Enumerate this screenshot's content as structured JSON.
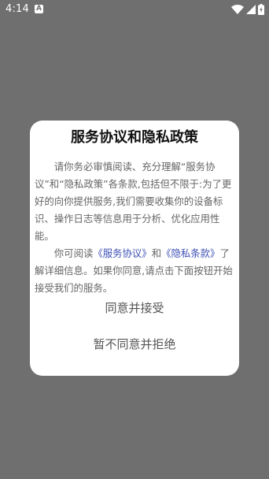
{
  "status_bar": {
    "time": "4:14",
    "notification_letter": "A"
  },
  "dialog": {
    "title": "服务协议和隐私政策",
    "paragraph1": "请你务必审慎阅读、充分理解“服务协议”和“隐私政策”各条款,包括但不限于:为了更好的向你提供服务,我们需要收集你的设备标识、操作日志等信息用于分析、优化应用性能。",
    "paragraph2_prefix": "你可阅读",
    "link_service": "《服务协议》",
    "paragraph2_and": "和",
    "link_privacy": "《隐私条款》",
    "paragraph2_suffix": "了解详细信息。如果你同意,请点击下面按钮开始接受我们的服务。",
    "accept_label": "同意并接受",
    "reject_label": "暂不同意并拒绝"
  },
  "colors": {
    "overlay": "#6f6f6f",
    "link": "#3f51b5",
    "body_text": "#666666"
  }
}
